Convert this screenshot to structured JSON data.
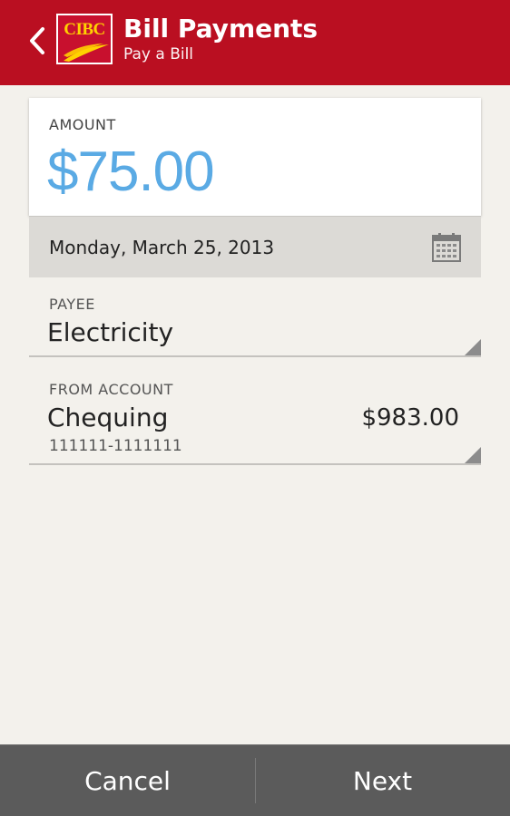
{
  "header": {
    "logo_text": "CIBC",
    "title": "Bill Payments",
    "subtitle": "Pay a Bill",
    "back_icon": "chevron-left-icon",
    "brand_color": "#ba0f21"
  },
  "amount": {
    "label": "AMOUNT",
    "value": "$75.00",
    "value_color": "#5aaae4"
  },
  "date": {
    "value": "Monday, March 25, 2013",
    "icon": "calendar-icon"
  },
  "payee": {
    "label": "PAYEE",
    "value": "Electricity"
  },
  "from_account": {
    "label": "FROM ACCOUNT",
    "name": "Chequing",
    "balance": "$983.00",
    "number": "111111-1111111"
  },
  "actions": {
    "cancel_label": "Cancel",
    "next_label": "Next"
  }
}
